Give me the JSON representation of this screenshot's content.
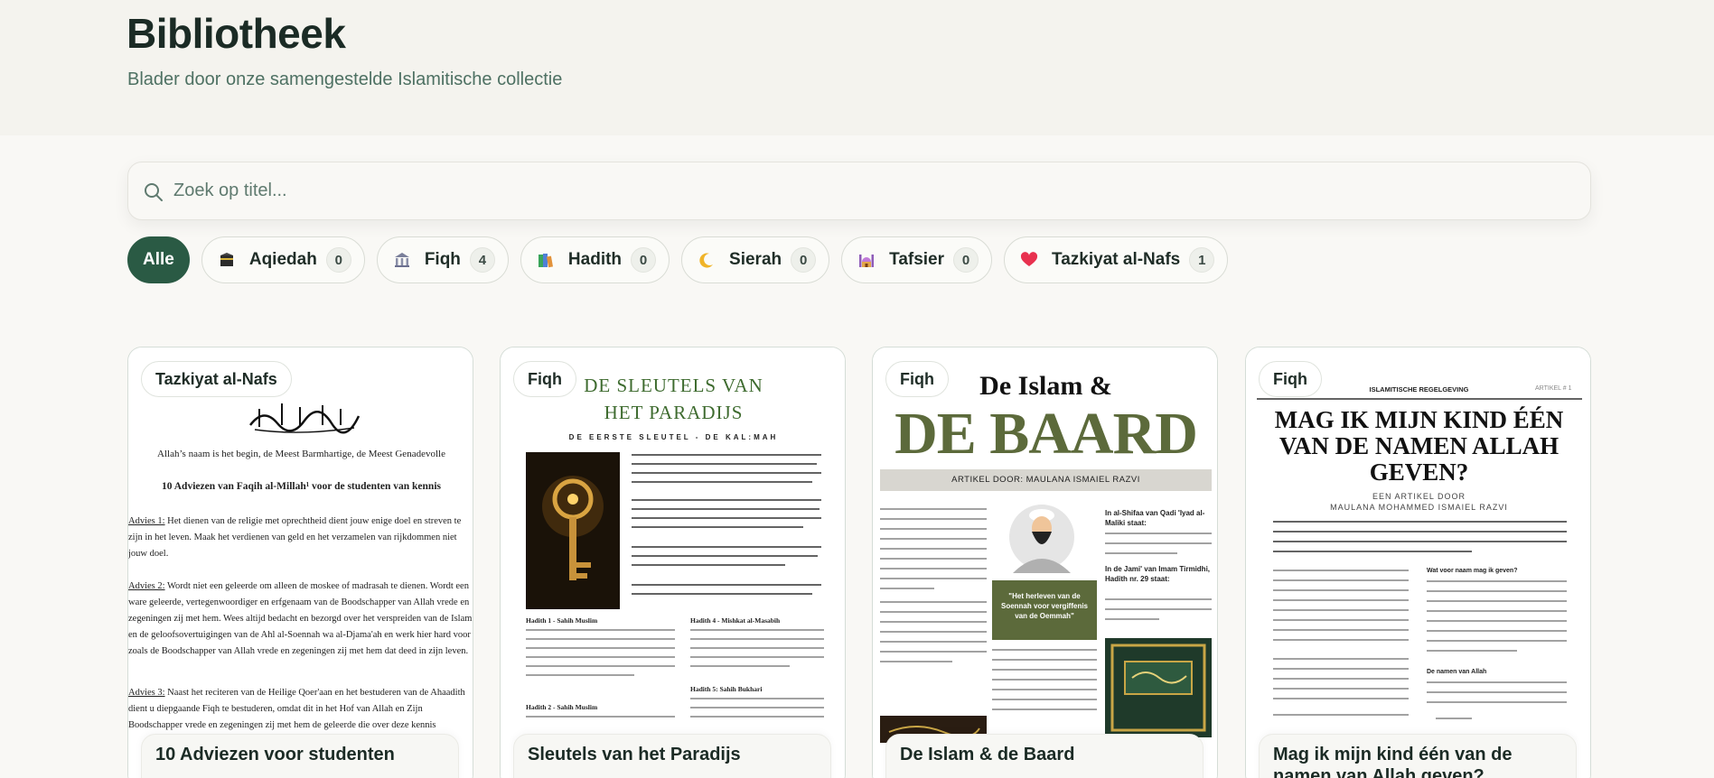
{
  "header": {
    "title": "Bibliotheek",
    "subtitle": "Blader door onze samengestelde Islamitische collectie"
  },
  "search": {
    "placeholder": "Zoek op titel..."
  },
  "filters": [
    {
      "label": "Alle",
      "active": true
    },
    {
      "label": "Aqiedah",
      "count": "0",
      "icon": "kaaba-icon"
    },
    {
      "label": "Fiqh",
      "count": "4",
      "icon": "building-icon"
    },
    {
      "label": "Hadith",
      "count": "0",
      "icon": "books-icon"
    },
    {
      "label": "Sierah",
      "count": "0",
      "icon": "crescent-icon"
    },
    {
      "label": "Tafsier",
      "count": "0",
      "icon": "mosque-icon"
    },
    {
      "label": "Tazkiyat al-Nafs",
      "count": "1",
      "icon": "heart-icon"
    }
  ],
  "cards": [
    {
      "badge": "Tazkiyat al-Nafs",
      "title": "10 Adviezen voor studenten",
      "cover": {
        "line1": "Allah’s naam is het begin, de Meest Barmhartige, de Meest Genadevolle",
        "heading": "10 Adviezen van Faqih al-Millah¹ voor de studenten van kennis",
        "advies1_label": "Advies 1:",
        "advies1": "Het dienen van de religie met oprechtheid dient jouw enige doel en streven te zijn in het leven. Maak het verdienen van geld en het verzamelen van rijkdommen niet jouw doel.",
        "advies2_label": "Advies 2:",
        "advies2": "Wordt niet een geleerde om alleen de moskee of madrasah te dienen. Wordt een ware geleerde, vertegenwoordiger en erfgenaam van de Boodschapper van Allah vrede en zegeningen zij met hem. Wees altijd bedacht en bezorgd over het verspreiden van de Islam en de geloofsovertuigingen van de Ahl al-Soennah wa al-Djama'ah en werk hier hard voor zoals de Boodschapper van Allah vrede en zegeningen zij met hem dat deed in zijn leven.",
        "advies3_label": "Advies 3:",
        "advies3": "Naast het reciteren van de Heilige Qoer'aan en het bestuderen van de Ahaadith dient u diepgaande Fiqh te bestuderen, omdat dit in het Hof van Allah en Zijn Boodschapper vrede en zegeningen zij met hem de geleerde die over deze kennis"
      }
    },
    {
      "badge": "Fiqh",
      "title": "Sleutels van het Paradijs",
      "cover": {
        "title_l1": "DE SLEUTELS VAN",
        "title_l2": "HET PARADIJS",
        "subtitle": "DE EERSTE SLEUTEL - DE KAL:MAH",
        "h1": "Hadith 1 - Sahih Muslim",
        "h4": "Hadith 4 - Mishkat al-Masabih",
        "h5": "Hadith 5: Sahih Bukhari",
        "h2": "Hadith 2 - Sahih Muslim"
      }
    },
    {
      "badge": "Fiqh",
      "title": "De Islam & de Baard",
      "cover": {
        "title_l1": "De Islam &",
        "title_l2": "DE BAARD",
        "byline": "ARTIKEL DOOR: MAULANA ISMAIEL RAZVI",
        "side_heading": "In al-Shifaa van Qadi 'Iyad al-Maliki staat:",
        "quote_box": "\"Het herleven van de Soennah voor vergiffenis van de Oemmah\"",
        "tirmidhi": "In de Jami' van Imam Tirmidhi, Hadith nr. 29 staat:"
      }
    },
    {
      "badge": "Fiqh",
      "title": "Mag ik mijn kind één van de namen van Allah geven?",
      "cover": {
        "top_label": "ISLAMITISCHE REGELGEVING",
        "article_no": "ARTIKEL # 1",
        "headline": "MAG IK MIJN KIND ÉÉN VAN DE NAMEN ALLAH GEVEN?",
        "byline_l1": "EEN ARTIKEL DOOR",
        "byline_l2": "MAULANA MOHAMMED ISMAIEL RAZVI",
        "q1": "Wat voor naam mag ik geven?",
        "q2": "De namen van Allah"
      }
    }
  ],
  "colors": {
    "accent": "#2a5a44",
    "olive": "#5c6a3b",
    "gold": "#a58a2b"
  }
}
